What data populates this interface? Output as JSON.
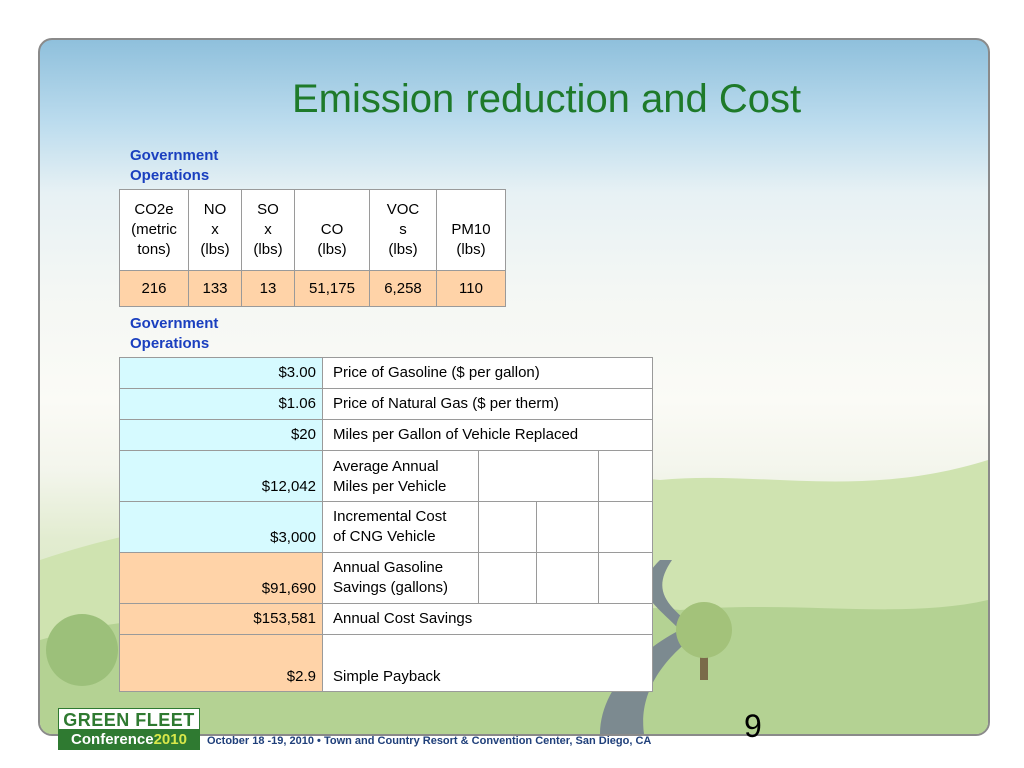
{
  "slide": {
    "title": "Emission reduction and Cost",
    "page_number": "9"
  },
  "emissions": {
    "section_label_line1": "Government",
    "section_label_line2": "Operations",
    "headers": [
      {
        "l1": "CO2e",
        "l2": "(metric",
        "l3": "tons)"
      },
      {
        "l1": "NO",
        "l2": "x",
        "l3": "(lbs)"
      },
      {
        "l1": "SO",
        "l2": "x",
        "l3": "(lbs)"
      },
      {
        "l1": "",
        "l2": "CO",
        "l3": "(lbs)"
      },
      {
        "l1": "VOC",
        "l2": "s",
        "l3": "(lbs)"
      },
      {
        "l1": "",
        "l2": "PM10",
        "l3": "(lbs)"
      }
    ],
    "values": [
      "216",
      "133",
      "13",
      "51,175",
      "6,258",
      "110"
    ]
  },
  "cost": {
    "section_label_line1": "Government",
    "section_label_line2": "Operations",
    "rows": [
      {
        "value": "$3.00",
        "label1": "Price of Gasoline ($ per gallon)",
        "label2": ""
      },
      {
        "value": "$1.06",
        "label1": "Price of Natural Gas ($ per therm)",
        "label2": ""
      },
      {
        "value": "$20",
        "label1": "Miles per Gallon of Vehicle Replaced",
        "label2": ""
      },
      {
        "value": "$12,042",
        "label1": "Average Annual",
        "label2": "Miles per Vehicle"
      },
      {
        "value": "$3,000",
        "label1": "Incremental Cost",
        "label2": "of CNG Vehicle"
      },
      {
        "value": "$91,690",
        "label1": "Annual Gasoline",
        "label2": "Savings (gallons)"
      },
      {
        "value": "$153,581",
        "label1": "Annual Cost Savings",
        "label2": ""
      },
      {
        "value": "$2.9",
        "label1": "",
        "label2": "Simple Payback"
      }
    ]
  },
  "footer": {
    "logo_line1": "GREEN FLEET",
    "logo_line2_word": "Conference",
    "logo_line2_year": "2010",
    "event_info": "October 18 -19, 2010 • Town and Country Resort & Convention Center, San Diego, CA"
  },
  "colors": {
    "title": "#1e7a2a",
    "section_label": "#1a3fbf",
    "peach_cell": "#ffd3a8",
    "blue_cell": "#d6faff"
  }
}
